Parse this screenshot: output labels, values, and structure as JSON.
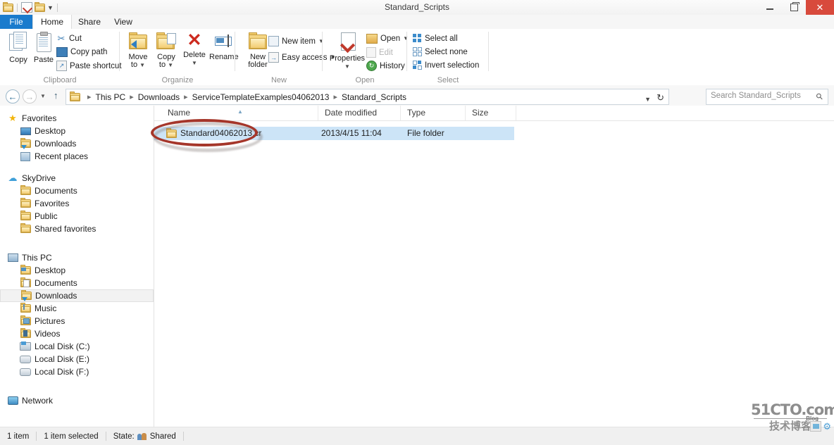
{
  "window": {
    "title": "Standard_Scripts",
    "quick_access": [
      "folder-icon",
      "properties-icon",
      "new-folder-icon",
      "dropdown-arrow-icon"
    ],
    "controls": {
      "minimize": "minimize-icon",
      "restore": "restore-icon",
      "close": "close-icon"
    }
  },
  "ribbon": {
    "tabs": [
      {
        "label": "File",
        "active": false,
        "accent": "#1a7bcd"
      },
      {
        "label": "Home",
        "active": true
      },
      {
        "label": "Share",
        "active": false
      },
      {
        "label": "View",
        "active": false
      }
    ],
    "collapse_icon": "chevron-up-icon",
    "help_icon": "help-icon",
    "groups": [
      {
        "name": "Clipboard",
        "big_buttons": [
          {
            "label": "Copy",
            "icon": "copy-icon"
          },
          {
            "label": "Paste",
            "icon": "paste-icon"
          }
        ],
        "small_buttons": [
          {
            "label": "Cut",
            "icon": "scissors-icon"
          },
          {
            "label": "Copy path",
            "icon": "copy-path-icon"
          },
          {
            "label": "Paste shortcut",
            "icon": "paste-shortcut-icon"
          }
        ]
      },
      {
        "name": "Organize",
        "big_buttons": [
          {
            "label": "Move",
            "label2": "to",
            "icon": "move-to-icon",
            "caret": true
          },
          {
            "label": "Copy",
            "label2": "to",
            "icon": "copy-to-icon",
            "caret": true
          },
          {
            "label": "Delete",
            "icon": "delete-icon",
            "caret": true
          },
          {
            "label": "Rename",
            "icon": "rename-icon"
          }
        ],
        "small_buttons": []
      },
      {
        "name": "New",
        "big_buttons": [
          {
            "label": "New",
            "label2": "folder",
            "icon": "new-folder-icon"
          }
        ],
        "small_buttons": [
          {
            "label": "New item",
            "icon": "new-item-icon",
            "caret": true
          },
          {
            "label": "Easy access",
            "icon": "easy-access-icon",
            "caret": true
          }
        ]
      },
      {
        "name": "Open",
        "big_buttons": [
          {
            "label": "Properties",
            "icon": "properties-icon",
            "caret": true
          }
        ],
        "small_buttons": [
          {
            "label": "Open",
            "icon": "open-icon",
            "caret": true,
            "disabled": false
          },
          {
            "label": "Edit",
            "icon": "edit-icon",
            "disabled": true
          },
          {
            "label": "History",
            "icon": "history-icon",
            "disabled": false
          }
        ]
      },
      {
        "name": "Select",
        "big_buttons": [],
        "small_buttons": [
          {
            "label": "Select all",
            "icon": "select-all-icon"
          },
          {
            "label": "Select none",
            "icon": "select-none-icon"
          },
          {
            "label": "Invert selection",
            "icon": "invert-selection-icon"
          }
        ]
      }
    ]
  },
  "address_bar": {
    "back_icon": "back-arrow-icon",
    "forward_icon": "forward-arrow-icon",
    "recent_icon": "recent-locations-icon",
    "up_icon": "up-arrow-icon",
    "folder_icon": "folder-icon",
    "breadcrumbs": [
      "This PC",
      "Downloads",
      "ServiceTemplateExamples04062013",
      "Standard_Scripts"
    ],
    "dropdown_icon": "chevron-down-icon",
    "refresh_icon": "refresh-icon",
    "search_placeholder": "Search Standard_Scripts",
    "search_value": "",
    "search_icon": "search-icon"
  },
  "nav_pane": {
    "sections": [
      {
        "root": {
          "label": "Favorites",
          "icon": "star-icon"
        },
        "children": [
          {
            "label": "Desktop",
            "icon": "desktop-icon"
          },
          {
            "label": "Downloads",
            "icon": "downloads-icon"
          },
          {
            "label": "Recent places",
            "icon": "recent-places-icon"
          }
        ]
      },
      {
        "root": {
          "label": "SkyDrive",
          "icon": "cloud-icon"
        },
        "children": [
          {
            "label": "Documents",
            "icon": "folder-icon"
          },
          {
            "label": "Favorites",
            "icon": "folder-icon"
          },
          {
            "label": "Public",
            "icon": "folder-icon"
          },
          {
            "label": "Shared favorites",
            "icon": "folder-icon"
          }
        ]
      },
      {
        "root": {
          "label": "This PC",
          "icon": "this-pc-icon"
        },
        "children": [
          {
            "label": "Desktop",
            "icon": "desktop-folder-icon"
          },
          {
            "label": "Documents",
            "icon": "documents-folder-icon"
          },
          {
            "label": "Downloads",
            "icon": "downloads-folder-icon",
            "selected": true
          },
          {
            "label": "Music",
            "icon": "music-folder-icon"
          },
          {
            "label": "Pictures",
            "icon": "pictures-folder-icon"
          },
          {
            "label": "Videos",
            "icon": "videos-folder-icon"
          },
          {
            "label": "Local Disk (C:)",
            "icon": "system-drive-icon"
          },
          {
            "label": "Local Disk (E:)",
            "icon": "drive-icon"
          },
          {
            "label": "Local Disk (F:)",
            "icon": "drive-icon"
          }
        ]
      },
      {
        "root": {
          "label": "Network",
          "icon": "network-icon"
        },
        "children": []
      }
    ]
  },
  "file_list": {
    "columns": [
      {
        "label": "Name",
        "sorted": true,
        "sort_dir": "asc"
      },
      {
        "label": "Date modified"
      },
      {
        "label": "Type"
      },
      {
        "label": "Size"
      }
    ],
    "rows": [
      {
        "name": "Standard04062013.cr",
        "date_modified": "2013/4/15 11:04",
        "type": "File folder",
        "size": "",
        "icon": "folder-icon",
        "selected": true
      }
    ]
  },
  "annotation": {
    "shape": "ellipse",
    "color": "#a5362a"
  },
  "status_bar": {
    "item_count": "1 item",
    "selection": "1 item selected",
    "state_label": "State:",
    "state_value": "Shared",
    "state_icon": "shared-users-icon"
  },
  "watermark": {
    "line1": "51CTO.com",
    "line2": "技术博客",
    "badge": "Blog"
  }
}
